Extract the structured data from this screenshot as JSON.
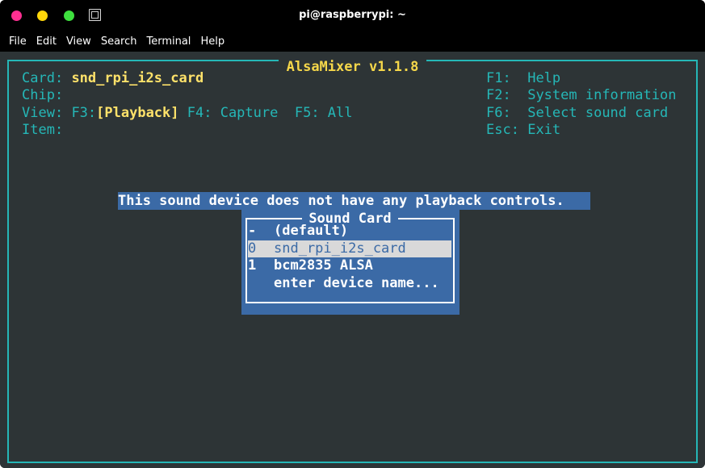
{
  "window": {
    "title": "pi@raspberrypi: ~",
    "controls": [
      "close",
      "minimize",
      "maximize"
    ],
    "app_icon": "terminal-icon"
  },
  "menubar": [
    "File",
    "Edit",
    "View",
    "Search",
    "Terminal",
    "Help"
  ],
  "alsamixer": {
    "title": "AlsaMixer v1.1.8",
    "card_label": "Card:",
    "card_value": "snd_rpi_i2s_card",
    "chip_label": "Chip:",
    "view_label": "View:",
    "view_f3_key": "F3:",
    "view_f3": "[Playback]",
    "view_f4": "F4: Capture",
    "view_f5": "F5: All",
    "item_label": "Item:",
    "keys": [
      {
        "key": "F1:",
        "action": "Help"
      },
      {
        "key": "F2:",
        "action": "System information"
      },
      {
        "key": "F6:",
        "action": "Select sound card"
      },
      {
        "key": "Esc:",
        "action": "Exit"
      }
    ],
    "message": "This sound device does not have any playback controls.",
    "dialog": {
      "title": "Sound Card",
      "options": [
        {
          "key": "-",
          "label": "(default)",
          "selected": false
        },
        {
          "key": "0",
          "label": "snd_rpi_i2s_card",
          "selected": true
        },
        {
          "key": "1",
          "label": "bcm2835 ALSA",
          "selected": false
        },
        {
          "key": "",
          "label": "enter device name...",
          "selected": false
        }
      ]
    }
  },
  "colors": {
    "background": "#2d3436",
    "cyan": "#25b7b7",
    "yellow": "#ffe26a",
    "dialog_blue": "#3b6aa6",
    "selected": "#d9d9d9"
  }
}
